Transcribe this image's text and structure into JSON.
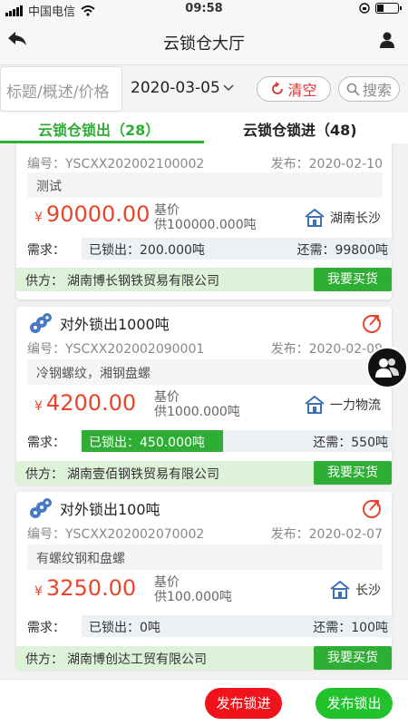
{
  "status": {
    "carrier": "中国电信",
    "time": "09:58"
  },
  "nav": {
    "title": "云锁仓大厅"
  },
  "search": {
    "placeholder": "标题/概述/价格",
    "date": "2020-03-05",
    "clear_label": "清空",
    "search_label": "搜索"
  },
  "tabs": [
    {
      "label": "云锁仓锁出（28）"
    },
    {
      "label": "云锁仓锁进（48)"
    }
  ],
  "cards": [
    {
      "code_label": "编号：",
      "code": "YSCXX202002100002",
      "pub_label": "发布：",
      "pub": "2020-02-10",
      "desc": "测试",
      "currency": "¥",
      "price": "90000.00",
      "base_label": "基价",
      "base": "供100000.000吨",
      "location": "湖南长沙",
      "need_label": "需求：",
      "locked": "已锁出：200.000吨",
      "locked_fraction": 0,
      "remain": "还需：99800吨",
      "supplier_label": "供方：",
      "supplier": "湖南博长钢铁贸易有限公司",
      "buy_label": "我要买货"
    },
    {
      "title": "对外锁出1000吨",
      "code_label": "编号：",
      "code": "YSCXX202002090001",
      "pub_label": "发布：",
      "pub": "2020-02-09",
      "desc": "冷钢螺纹，湘钢盘螺",
      "currency": "¥",
      "price": "4200.00",
      "base_label": "基价",
      "base": "供1000.000吨",
      "location": "一力物流",
      "need_label": "需求：",
      "locked": "已锁出：450.000吨",
      "locked_fraction": 0.45,
      "remain": "还需：550吨",
      "supplier_label": "供方：",
      "supplier": "湖南壹佰钢铁贸易有限公司",
      "buy_label": "我要买货"
    },
    {
      "title": "对外锁出100吨",
      "code_label": "编号：",
      "code": "YSCXX202002070002",
      "pub_label": "发布：",
      "pub": "2020-02-07",
      "desc": "有螺纹钢和盘螺",
      "currency": "¥",
      "price": "3250.00",
      "base_label": "基价",
      "base": "供100.000吨",
      "location": "长沙",
      "need_label": "需求：",
      "locked": "已锁出：0吨",
      "locked_fraction": 0,
      "remain": "还需：100吨",
      "supplier_label": "供方：",
      "supplier": "湖南博创达工贸有限公司",
      "buy_label": "我要买货"
    }
  ],
  "bottom": {
    "lock_in_label": "发布锁进",
    "lock_out_label": "发布锁出"
  },
  "colors": {
    "accent": "#2eae35",
    "price": "#e8452c",
    "danger": "#f0131b"
  },
  "icons": [
    "back-icon",
    "user-icon",
    "chevron-down-icon",
    "refresh-icon",
    "search-icon",
    "coil-icon",
    "share-icon",
    "warehouse-icon",
    "contacts-icon"
  ]
}
